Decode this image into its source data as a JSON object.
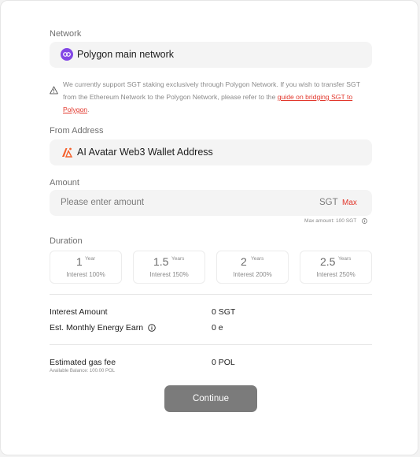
{
  "network": {
    "label": "Network",
    "value": "Polygon main network",
    "icon": "polygon-logo-icon",
    "icon_color": "#8247e5"
  },
  "notice": {
    "text": "We currently support SGT staking exclusively through Polygon Network. If you wish to transfer SGT from the Ethereum Network to the Polygon Network, please refer to the",
    "link_text": "guide on bridging SGT to Polygon",
    "suffix": ".",
    "icon": "warning-icon"
  },
  "from_address": {
    "label": "From Address",
    "value": "AI Avatar Web3 Wallet Address",
    "icon": "ai-avatar-logo-icon",
    "icon_color": "#f4602c"
  },
  "amount": {
    "label": "Amount",
    "placeholder": "Please enter amount",
    "unit": "SGT",
    "max_label": "Max",
    "max_hint": "Max amount: 100 SGT"
  },
  "duration": {
    "label": "Duration",
    "options": [
      {
        "value": "1",
        "unit": "Year",
        "interest": "Interest 100%"
      },
      {
        "value": "1.5",
        "unit": "Years",
        "interest": "Interest 150%"
      },
      {
        "value": "2",
        "unit": "Years",
        "interest": "Interest 200%"
      },
      {
        "value": "2.5",
        "unit": "Years",
        "interest": "Interest 250%"
      }
    ]
  },
  "summary": {
    "interest_amount_label": "Interest Amount",
    "interest_amount_value": "0 SGT",
    "energy_label": "Est. Monthly Energy Earn",
    "energy_value": "0 e"
  },
  "gas": {
    "label": "Estimated gas fee",
    "value": "0 POL",
    "balance": "Available Balance: 100.00 POL"
  },
  "continue_label": "Continue",
  "colors": {
    "accent_red": "#e2362b",
    "button_gray": "#7b7b7b",
    "field_bg": "#f4f4f4"
  }
}
